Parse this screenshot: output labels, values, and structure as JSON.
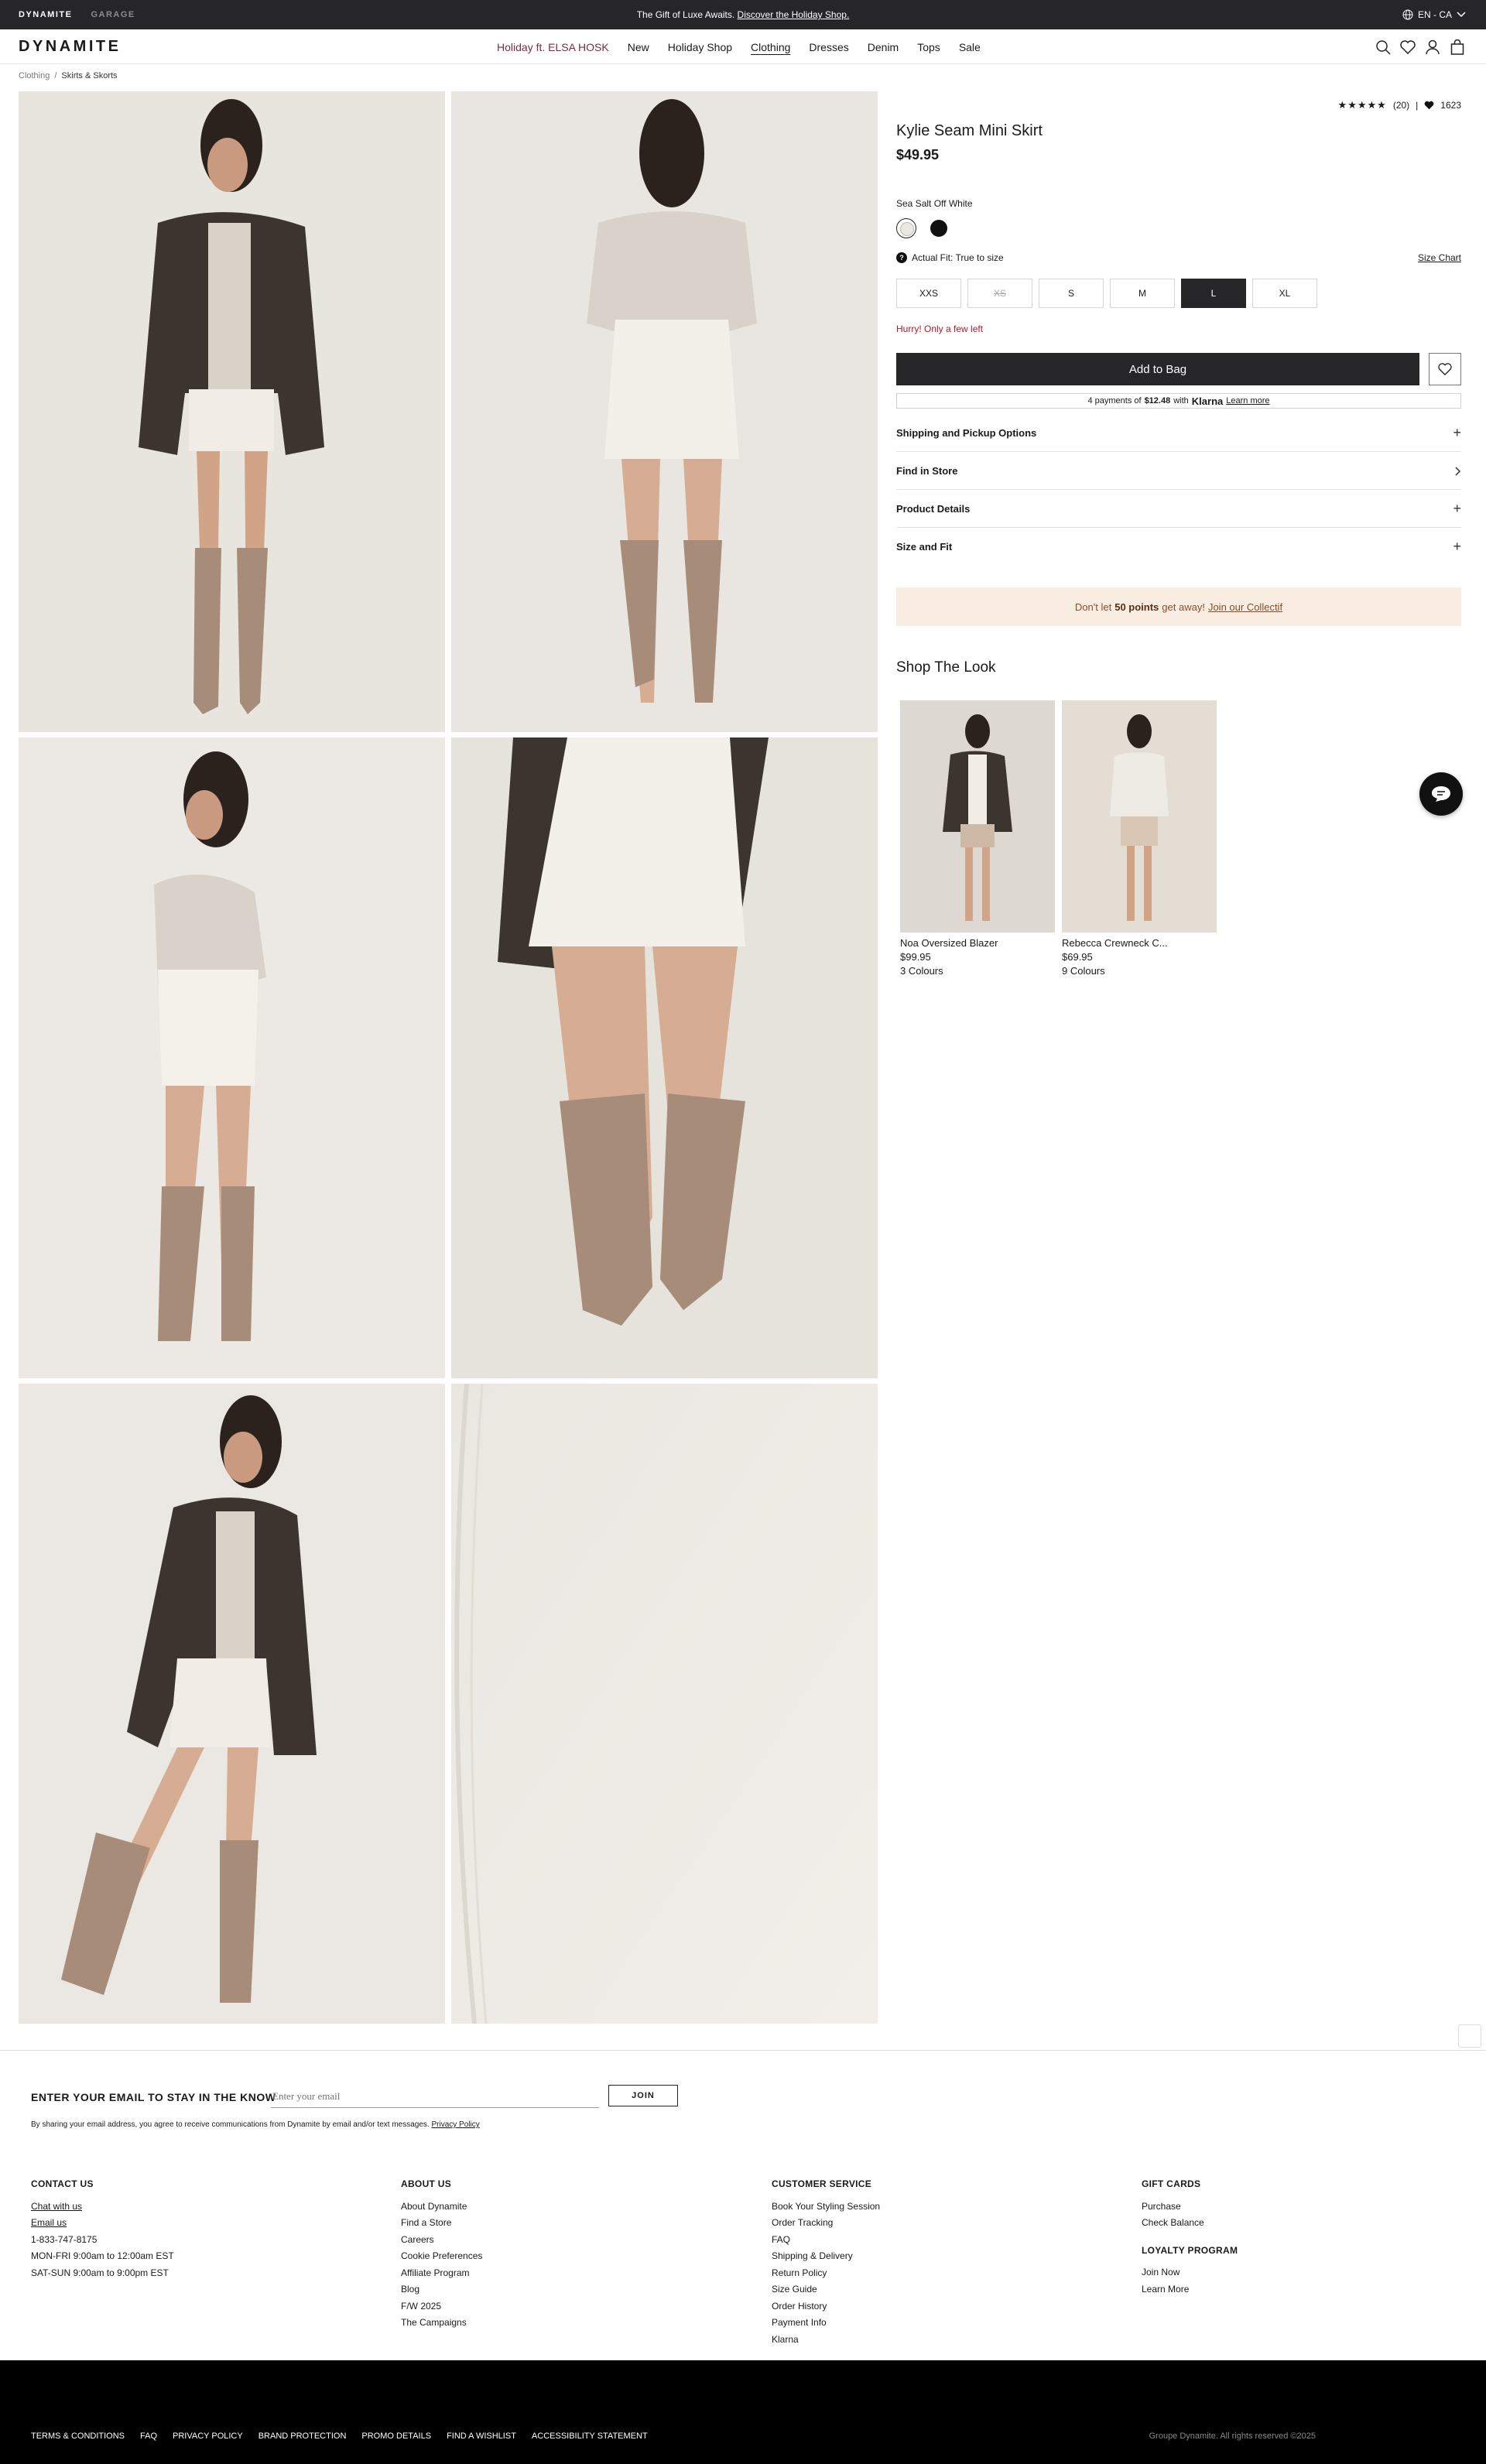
{
  "promo": {
    "brand1": "DYNAMITE",
    "brand2": "GARAGE",
    "text": "The Gift of Luxe Awaits.",
    "link": "Discover the Holiday Shop.",
    "lang": "EN - CA"
  },
  "header": {
    "logo": "DYNAMITE",
    "nav": [
      "Holiday ft. ELSA HOSK",
      "New",
      "Holiday Shop",
      "Clothing",
      "Dresses",
      "Denim",
      "Tops",
      "Sale"
    ],
    "icons": [
      "search-icon",
      "heart-icon",
      "user-icon",
      "bag-icon"
    ]
  },
  "breadcrumb": {
    "items": [
      "Clothing",
      "Skirts & Skorts"
    ],
    "separator": "/"
  },
  "product": {
    "rating_count": "(20)",
    "stars": "★★★★★",
    "likes": "1623",
    "title": "Kylie Seam Mini Skirt",
    "price": "$49.95",
    "color": "Sea Salt Off White",
    "fit_label": "Actual Fit: True to size",
    "size_chart": "Size Chart",
    "sizes": [
      "XXS",
      "XS",
      "S",
      "M",
      "L",
      "XL"
    ],
    "hurry": "Hurry! Only a few left",
    "add_to_bag": "Add to Bag",
    "klarna": {
      "pre": "4 payments of",
      "amount": "$12.48",
      "with": "with",
      "brand": "Klarna",
      "learn": "Learn more"
    },
    "accordions": [
      "Shipping and Pickup Options",
      "Find in Store",
      "Product Details",
      "Size and Fit"
    ],
    "loyalty": {
      "pre": "Don't let",
      "points": "50 points",
      "mid": "get away!",
      "link": "Join our Collectif"
    },
    "shop_look_title": "Shop The Look",
    "look": [
      {
        "name": "Noa Oversized Blazer",
        "price": "$99.95",
        "colours": "3 Colours"
      },
      {
        "name": "Rebecca Crewneck C...",
        "price": "$69.95",
        "colours": "9 Colours"
      }
    ]
  },
  "newsletter": {
    "title": "ENTER YOUR EMAIL TO STAY IN THE KNOW",
    "placeholder": "Enter your email",
    "button": "JOIN",
    "legal": "By sharing your email address, you agree to receive communications from Dynamite by email and/or text messages.",
    "privacy": "Privacy Policy"
  },
  "footer": {
    "contact": {
      "title": "CONTACT US",
      "items": [
        "Chat with us",
        "Email us",
        "1-833-747-8175",
        "MON-FRI 9:00am to 12:00am EST",
        "SAT-SUN 9:00am to 9:00pm EST"
      ]
    },
    "about": {
      "title": "ABOUT US",
      "items": [
        "About Dynamite",
        "Find a Store",
        "Careers",
        "Cookie Preferences",
        "Affiliate Program",
        "Blog",
        "F/W 2025",
        "The Campaigns"
      ]
    },
    "service": {
      "title": "CUSTOMER SERVICE",
      "items": [
        "Book Your Styling Session",
        "Order Tracking",
        "FAQ",
        "Shipping & Delivery",
        "Return Policy",
        "Size Guide",
        "Order History",
        "Payment Info",
        "Klarna"
      ]
    },
    "gift": {
      "title": "GIFT CARDS",
      "items": [
        "Purchase",
        "Check Balance"
      ]
    },
    "loyalty": {
      "title": "LOYALTY PROGRAM",
      "items": [
        "Join Now",
        "Learn More"
      ]
    },
    "bottom_links": [
      "TERMS & CONDITIONS",
      "FAQ",
      "PRIVACY POLICY",
      "BRAND PROTECTION",
      "PROMO DETAILS",
      "FIND A WISHLIST",
      "ACCESSIBILITY STATEMENT"
    ],
    "copyright": "Groupe Dynamite. All rights reserved ©2025"
  },
  "colors": {
    "dark": "#262629",
    "holiday": "#7a2b4a",
    "hurry": "#b01a2a",
    "loyalty_bg": "#faeee3"
  }
}
